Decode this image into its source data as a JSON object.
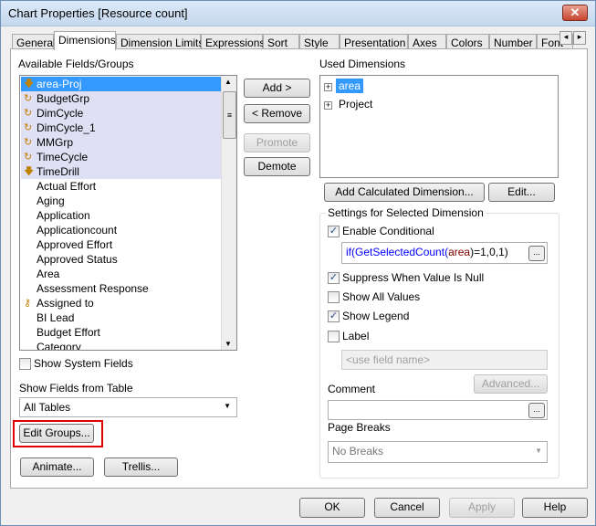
{
  "window": {
    "title": "Chart Properties [Resource count]",
    "close": "✕"
  },
  "tabs": [
    "General",
    "Dimensions",
    "Dimension Limits",
    "Expressions",
    "Sort",
    "Style",
    "Presentation",
    "Axes",
    "Colors",
    "Number",
    "Font"
  ],
  "tab_scroll": {
    "left": "◂",
    "right": "▸"
  },
  "available": {
    "label": "Available Fields/Groups",
    "items": [
      {
        "label": "area-Proj",
        "icon": "drill-group-icon",
        "group": true,
        "selected": true
      },
      {
        "label": "BudgetGrp",
        "icon": "cyclic-group-icon",
        "group": true
      },
      {
        "label": "DimCycle",
        "icon": "cyclic-group-icon",
        "group": true
      },
      {
        "label": "DimCycle_1",
        "icon": "cyclic-group-icon",
        "group": true
      },
      {
        "label": "MMGrp",
        "icon": "cyclic-group-icon",
        "group": true
      },
      {
        "label": "TimeCycle",
        "icon": "cyclic-group-icon",
        "group": true
      },
      {
        "label": "TimeDrill",
        "icon": "drill-group-icon",
        "group": true
      },
      {
        "label": "Actual Effort"
      },
      {
        "label": "Aging"
      },
      {
        "label": "Application"
      },
      {
        "label": "Applicationcount"
      },
      {
        "label": "Approved Effort"
      },
      {
        "label": "Approved Status"
      },
      {
        "label": "Area"
      },
      {
        "label": "Assessment Response"
      },
      {
        "label": "Assigned to",
        "icon": "key-icon"
      },
      {
        "label": "BI Lead"
      },
      {
        "label": "Budget Effort"
      },
      {
        "label": "Category"
      }
    ]
  },
  "middle_buttons": {
    "add": "Add >",
    "remove": "< Remove",
    "promote": "Promote",
    "demote": "Demote"
  },
  "used": {
    "label": "Used Dimensions",
    "items": [
      {
        "label": "area",
        "selected": true
      },
      {
        "label": "Project"
      }
    ],
    "add_calc": "Add Calculated Dimension...",
    "edit": "Edit..."
  },
  "settings": {
    "legend": "Settings for Selected Dimension",
    "enable_conditional": "Enable Conditional",
    "enable_conditional_checked": true,
    "condition": {
      "p1": "if(",
      "p2": "GetSelectedCount",
      "p3": "(",
      "p4": "area",
      "p5": ")=1,0,1)"
    },
    "suppress": "Suppress When Value Is Null",
    "suppress_checked": true,
    "show_all": "Show All Values",
    "show_all_checked": false,
    "show_legend": "Show Legend",
    "show_legend_checked": true,
    "label": "Label",
    "label_checked": false,
    "label_placeholder": "<use field name>",
    "advanced": "Advanced...",
    "comment": "Comment",
    "comment_value": "",
    "page_breaks": "Page Breaks",
    "page_breaks_value": "No Breaks",
    "ellipsis": "..."
  },
  "left_bottom": {
    "show_system": "Show System Fields",
    "show_fields_from": "Show Fields from Table",
    "table_value": "All Tables",
    "edit_groups": "Edit Groups...",
    "animate": "Animate...",
    "trellis": "Trellis..."
  },
  "footer": {
    "ok": "OK",
    "cancel": "Cancel",
    "apply": "Apply",
    "help": "Help"
  },
  "colors": {
    "selection": "#3399ff",
    "group_bg": "#e0e0f4",
    "highlight": "#e00000",
    "func": "#0000ff",
    "fieldref": "#800000"
  }
}
